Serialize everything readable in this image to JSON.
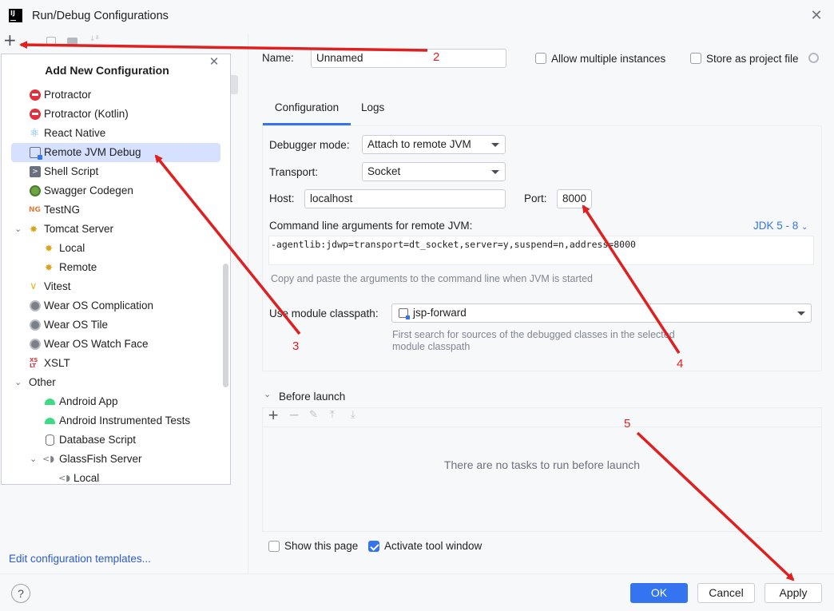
{
  "window": {
    "title": "Run/Debug Configurations",
    "app_icon_text": "IJ",
    "close_glyph": "✕"
  },
  "left_toolbar": {
    "add_glyph": "+"
  },
  "popup": {
    "title": "Add New Configuration",
    "close_glyph": "✕",
    "items": [
      {
        "label": "Protractor",
        "icon": "protractor-icon",
        "selected": false
      },
      {
        "label": "Protractor (Kotlin)",
        "icon": "protractor-icon",
        "selected": false
      },
      {
        "label": "React Native",
        "icon": "react-icon",
        "selected": false
      },
      {
        "label": "Remote JVM Debug",
        "icon": "remote-debug-icon",
        "selected": true
      },
      {
        "label": "Shell Script",
        "icon": "shell-icon",
        "selected": false
      },
      {
        "label": "Swagger Codegen",
        "icon": "swagger-icon",
        "selected": false
      },
      {
        "label": "TestNG",
        "icon": "testng-icon",
        "selected": false
      },
      {
        "label": "Tomcat Server",
        "icon": "tomcat-icon",
        "expanded": true
      },
      {
        "label": "Local",
        "icon": "tomcat-icon"
      },
      {
        "label": "Remote",
        "icon": "tomcat-icon"
      },
      {
        "label": "Vitest",
        "icon": "vitest-icon"
      },
      {
        "label": "Wear OS Complication",
        "icon": "wear-os-icon"
      },
      {
        "label": "Wear OS Tile",
        "icon": "wear-os-icon"
      },
      {
        "label": "Wear OS Watch Face",
        "icon": "wear-os-icon"
      },
      {
        "label": "XSLT",
        "icon": "xslt-icon"
      },
      {
        "label": "Other",
        "expanded": true
      },
      {
        "label": "Android App",
        "icon": "android-icon"
      },
      {
        "label": "Android Instrumented Tests",
        "icon": "android-icon"
      },
      {
        "label": "Database Script",
        "icon": "database-icon"
      },
      {
        "label": "GlassFish Server",
        "icon": "glassfish-icon",
        "expanded": true
      },
      {
        "label": "Local",
        "icon": "glassfish-icon"
      }
    ]
  },
  "edit_templates_link": "Edit configuration templates...",
  "form": {
    "name_label": "Name:",
    "name_value": "Unnamed",
    "allow_multiple_label": "Allow multiple instances",
    "allow_multiple_checked": false,
    "store_project_label": "Store as project file",
    "store_project_checked": false,
    "tabs": [
      "Configuration",
      "Logs"
    ],
    "active_tab": "Configuration",
    "debugger_mode_label": "Debugger mode:",
    "debugger_mode_value": "Attach to remote JVM",
    "transport_label": "Transport:",
    "transport_value": "Socket",
    "host_label": "Host:",
    "host_value": "localhost",
    "port_label": "Port:",
    "port_value": "8000",
    "cmd_args_label": "Command line arguments for remote JVM:",
    "jdk_link": "JDK 5 - 8",
    "cmd_args_value": "-agentlib:jdwp=transport=dt_socket,server=y,suspend=n,address=8000",
    "cmd_args_hint": "Copy and paste the arguments to the command line when JVM is started",
    "module_classpath_label": "Use module classpath:",
    "module_classpath_value": "jsp-forward",
    "module_hint_line1": "First search for sources of the debugged classes in the selected",
    "module_hint_line2": "module classpath",
    "before_launch_label": "Before launch",
    "empty_tasks": "There are no tasks to run before launch",
    "show_page_label": "Show this page",
    "show_page_checked": false,
    "activate_tool_label": "Activate tool window",
    "activate_tool_checked": true
  },
  "buttons": {
    "help": "?",
    "ok": "OK",
    "cancel": "Cancel",
    "apply": "Apply"
  },
  "annotations": {
    "n2": "2",
    "n3": "3",
    "n4": "4",
    "n5": "5"
  },
  "colors": {
    "accent": "#3574f0",
    "annotation": "#e02020",
    "selection": "#d5e1ff"
  }
}
